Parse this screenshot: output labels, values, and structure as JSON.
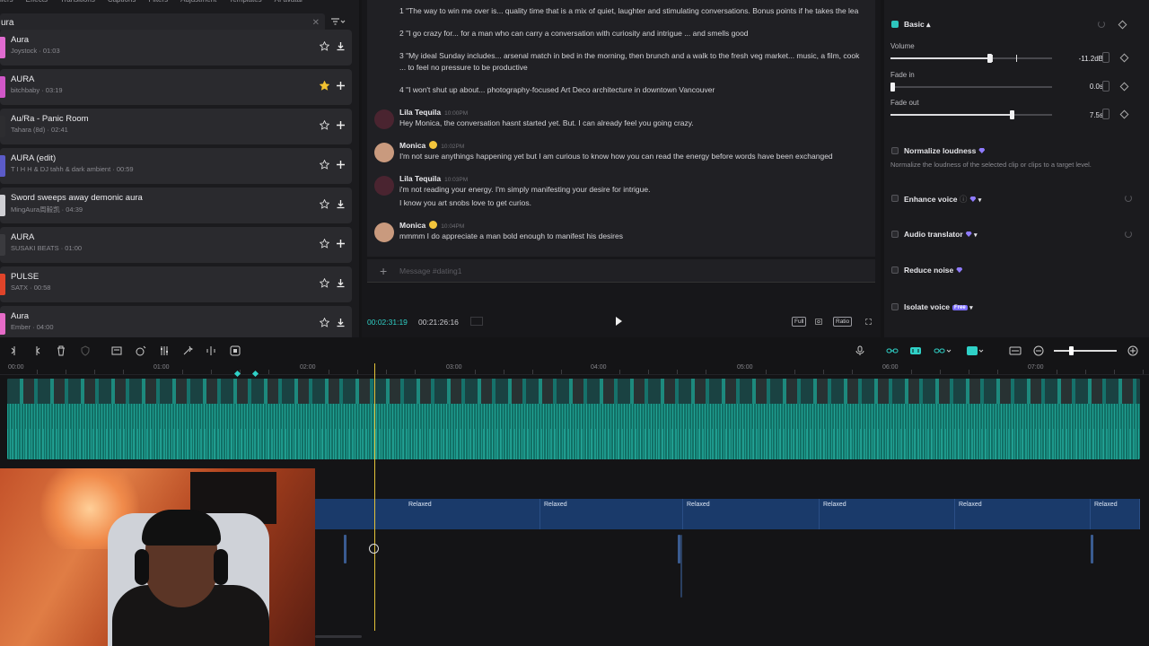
{
  "library": {
    "tabs": [
      "ilers",
      "Effects",
      "Transitions",
      "Captions",
      "Filters",
      "Adjustment",
      "Templates",
      "AI avatar"
    ],
    "search_value": "ura",
    "filter_icon": "filter-icon",
    "tracks": [
      {
        "name": "Aura",
        "meta": "Joystock · 01:03",
        "starred": false,
        "action": "download",
        "color": "#e06bd0"
      },
      {
        "name": "AURA",
        "meta": "bitchbaby · 03:19",
        "starred": true,
        "action": "add",
        "color": "#d157c8"
      },
      {
        "name": "Au/Ra - Panic Room",
        "meta": "Tahara (8d) · 02:41",
        "starred": false,
        "action": "add",
        "color": "#2d2d30"
      },
      {
        "name": "AURA (edit)",
        "meta": "T I H H & DJ tahh & dark ambient · 00:59",
        "starred": false,
        "action": "add",
        "color": "#5b5bc8"
      },
      {
        "name": "Sword sweeps away demonic aura",
        "meta": "MingAura周毅凯 · 04:39",
        "starred": false,
        "action": "download",
        "color": "#cfcfd4"
      },
      {
        "name": "AURA",
        "meta": "SUSAKI BEATS · 01:00",
        "starred": false,
        "action": "add",
        "color": "#3a3a3e"
      },
      {
        "name": "PULSE",
        "meta": "SATX · 00:58",
        "starred": false,
        "action": "download",
        "color": "#e0442a"
      },
      {
        "name": "Aura",
        "meta": "Ember · 04:00",
        "starred": false,
        "action": "download",
        "color": "#e66bc8"
      }
    ]
  },
  "chat": {
    "lines": [
      "1 \"The way to win me over is... quality time that is a mix of quiet, laughter and stimulating conversations. Bonus points if he takes the lea",
      "2 \"I go crazy for... for a man who can carry a conversation with curiosity and intrigue ... and smells good",
      "3 \"My ideal Sunday includes... arsenal match in bed in the morning, then brunch and a walk to the fresh veg market... music, a film, cook",
      "... to feel no pressure to be productive",
      "4 \"I won't shut up about... photography-focused Art Deco architecture in downtown Vancouver"
    ],
    "messages": [
      {
        "user": "Lila Tequila",
        "time": "10:00PM",
        "emoji": false,
        "text": [
          "Hey Monica, the conversation hasnt started yet. But. I can already feel you going crazy."
        ]
      },
      {
        "user": "Monica",
        "time": "10:02PM",
        "emoji": true,
        "text": [
          "I'm not sure anythings happening yet but I am curious to know how you can read the energy before words have been exchanged"
        ]
      },
      {
        "user": "Lila Tequila",
        "time": "10:03PM",
        "emoji": false,
        "text": [
          "i'm not reading your energy. I'm simply manifesting your desire for intrigue.",
          "I know you art snobs love to get curios."
        ]
      },
      {
        "user": "Monica",
        "time": "10:04PM",
        "emoji": true,
        "text": [
          "mmmm I do appreciate a man bold enough to manifest his desires"
        ]
      }
    ],
    "message_placeholder": "Message #dating1"
  },
  "player": {
    "current_time": "00:02:31:19",
    "total_time": "00:21:26:16",
    "full_label": "Full",
    "ratio_label": "Ratio"
  },
  "inspector": {
    "section_label": "Basic",
    "volume_label": "Volume",
    "volume_value": "-11.2dB",
    "volume_fraction": 0.6,
    "fade_in_label": "Fade in",
    "fade_in_value": "0.0s",
    "fade_in_fraction": 0.0,
    "fade_out_label": "Fade out",
    "fade_out_value": "7.5s",
    "fade_out_fraction": 0.75,
    "normalize_label": "Normalize loudness",
    "normalize_desc": "Normalize the loudness of the selected clip or clips to a target level.",
    "enhance_label": "Enhance voice",
    "translator_label": "Audio translator",
    "reduce_label": "Reduce noise",
    "isolate_label": "Isolate voice",
    "free_badge": "Free",
    "accent_color": "#2ec6bd",
    "pro_color": "#8f7bff"
  },
  "timeline": {
    "ruler": [
      "00:00",
      "01:00",
      "02:00",
      "03:00",
      "04:00",
      "05:00",
      "06:00",
      "07:00"
    ],
    "caption_segments": [
      "Relaxed",
      "Relaxed",
      "Relaxed",
      "Relaxed",
      "Relaxed",
      "Relaxed"
    ],
    "playhead_color": "#e4c339"
  }
}
